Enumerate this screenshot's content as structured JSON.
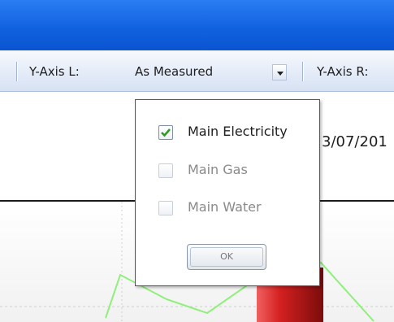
{
  "toolbar": {
    "y_axis_left_label": "Y-Axis L:",
    "y_axis_left_value": "As Measured",
    "y_axis_right_label": "Y-Axis R:"
  },
  "chart": {
    "date_fragment": "3/07/201"
  },
  "popup": {
    "options": [
      {
        "label": "Main Electricity",
        "checked": true,
        "enabled": true
      },
      {
        "label": "Main Gas",
        "checked": false,
        "enabled": false
      },
      {
        "label": "Main Water",
        "checked": false,
        "enabled": false
      }
    ],
    "ok_label": "OK"
  },
  "colors": {
    "titlebar": "#1a6ae8",
    "series_line": "#8ef07a",
    "bar": "#d42020",
    "check": "#2f9a1f"
  }
}
